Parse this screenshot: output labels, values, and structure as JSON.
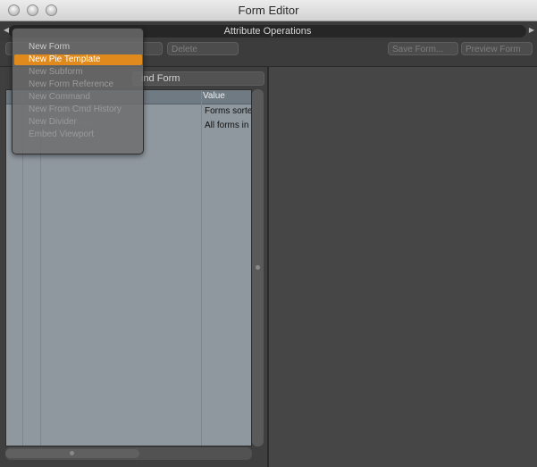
{
  "window": {
    "title": "Form Editor"
  },
  "attribute_bar": {
    "label": "Attribute Operations"
  },
  "toolbar": {
    "delete_label": "Delete",
    "save_label": "Save Form...",
    "preview_label": "Preview Form"
  },
  "left": {
    "find_form_label": "ind Form",
    "tree": {
      "value_header": "Value",
      "rows": [
        {
          "value": "Forms sorte"
        },
        {
          "value": "All forms in"
        }
      ],
      "ghost_text": "orms"
    }
  },
  "menu": {
    "items": [
      {
        "label": "New Form",
        "enabled": true
      },
      {
        "label": "New Pie Template",
        "enabled": true,
        "highlighted": true
      },
      {
        "label": "New Subform",
        "enabled": false
      },
      {
        "label": "New Form Reference",
        "enabled": false
      },
      {
        "label": "New Command",
        "enabled": false
      },
      {
        "label": "New From Cmd History",
        "enabled": false
      },
      {
        "label": "New Divider",
        "enabled": false
      },
      {
        "label": "Embed Viewport",
        "enabled": false
      }
    ]
  },
  "colors": {
    "highlight": "#e08a1e",
    "tree_bg": "#8f989f",
    "panel_bg": "#3f3f3f"
  }
}
